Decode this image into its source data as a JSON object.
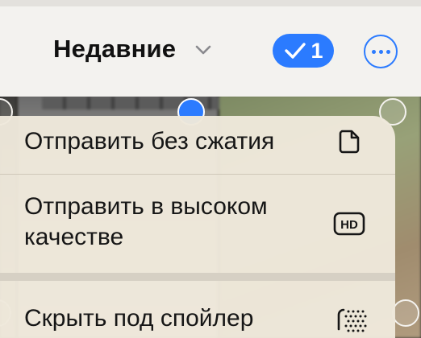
{
  "header": {
    "album_title": "Недавние",
    "album_chevron_icon": "chevron-down-icon",
    "selected_count": "1",
    "selected_check_icon": "checkmark-icon",
    "more_icon": "ellipsis-circle-icon"
  },
  "menu": {
    "items": [
      {
        "label": "Отправить без сжатия",
        "icon": "document-icon"
      },
      {
        "label": "Отправить в высоком качестве",
        "icon": "hd-icon"
      },
      {
        "label": "Скрыть под спойлер",
        "icon": "spoiler-dots-icon"
      }
    ]
  },
  "colors": {
    "accent": "#2b7bff",
    "menu_background": "#eee8db",
    "topbar_background": "#f3f2ef"
  }
}
